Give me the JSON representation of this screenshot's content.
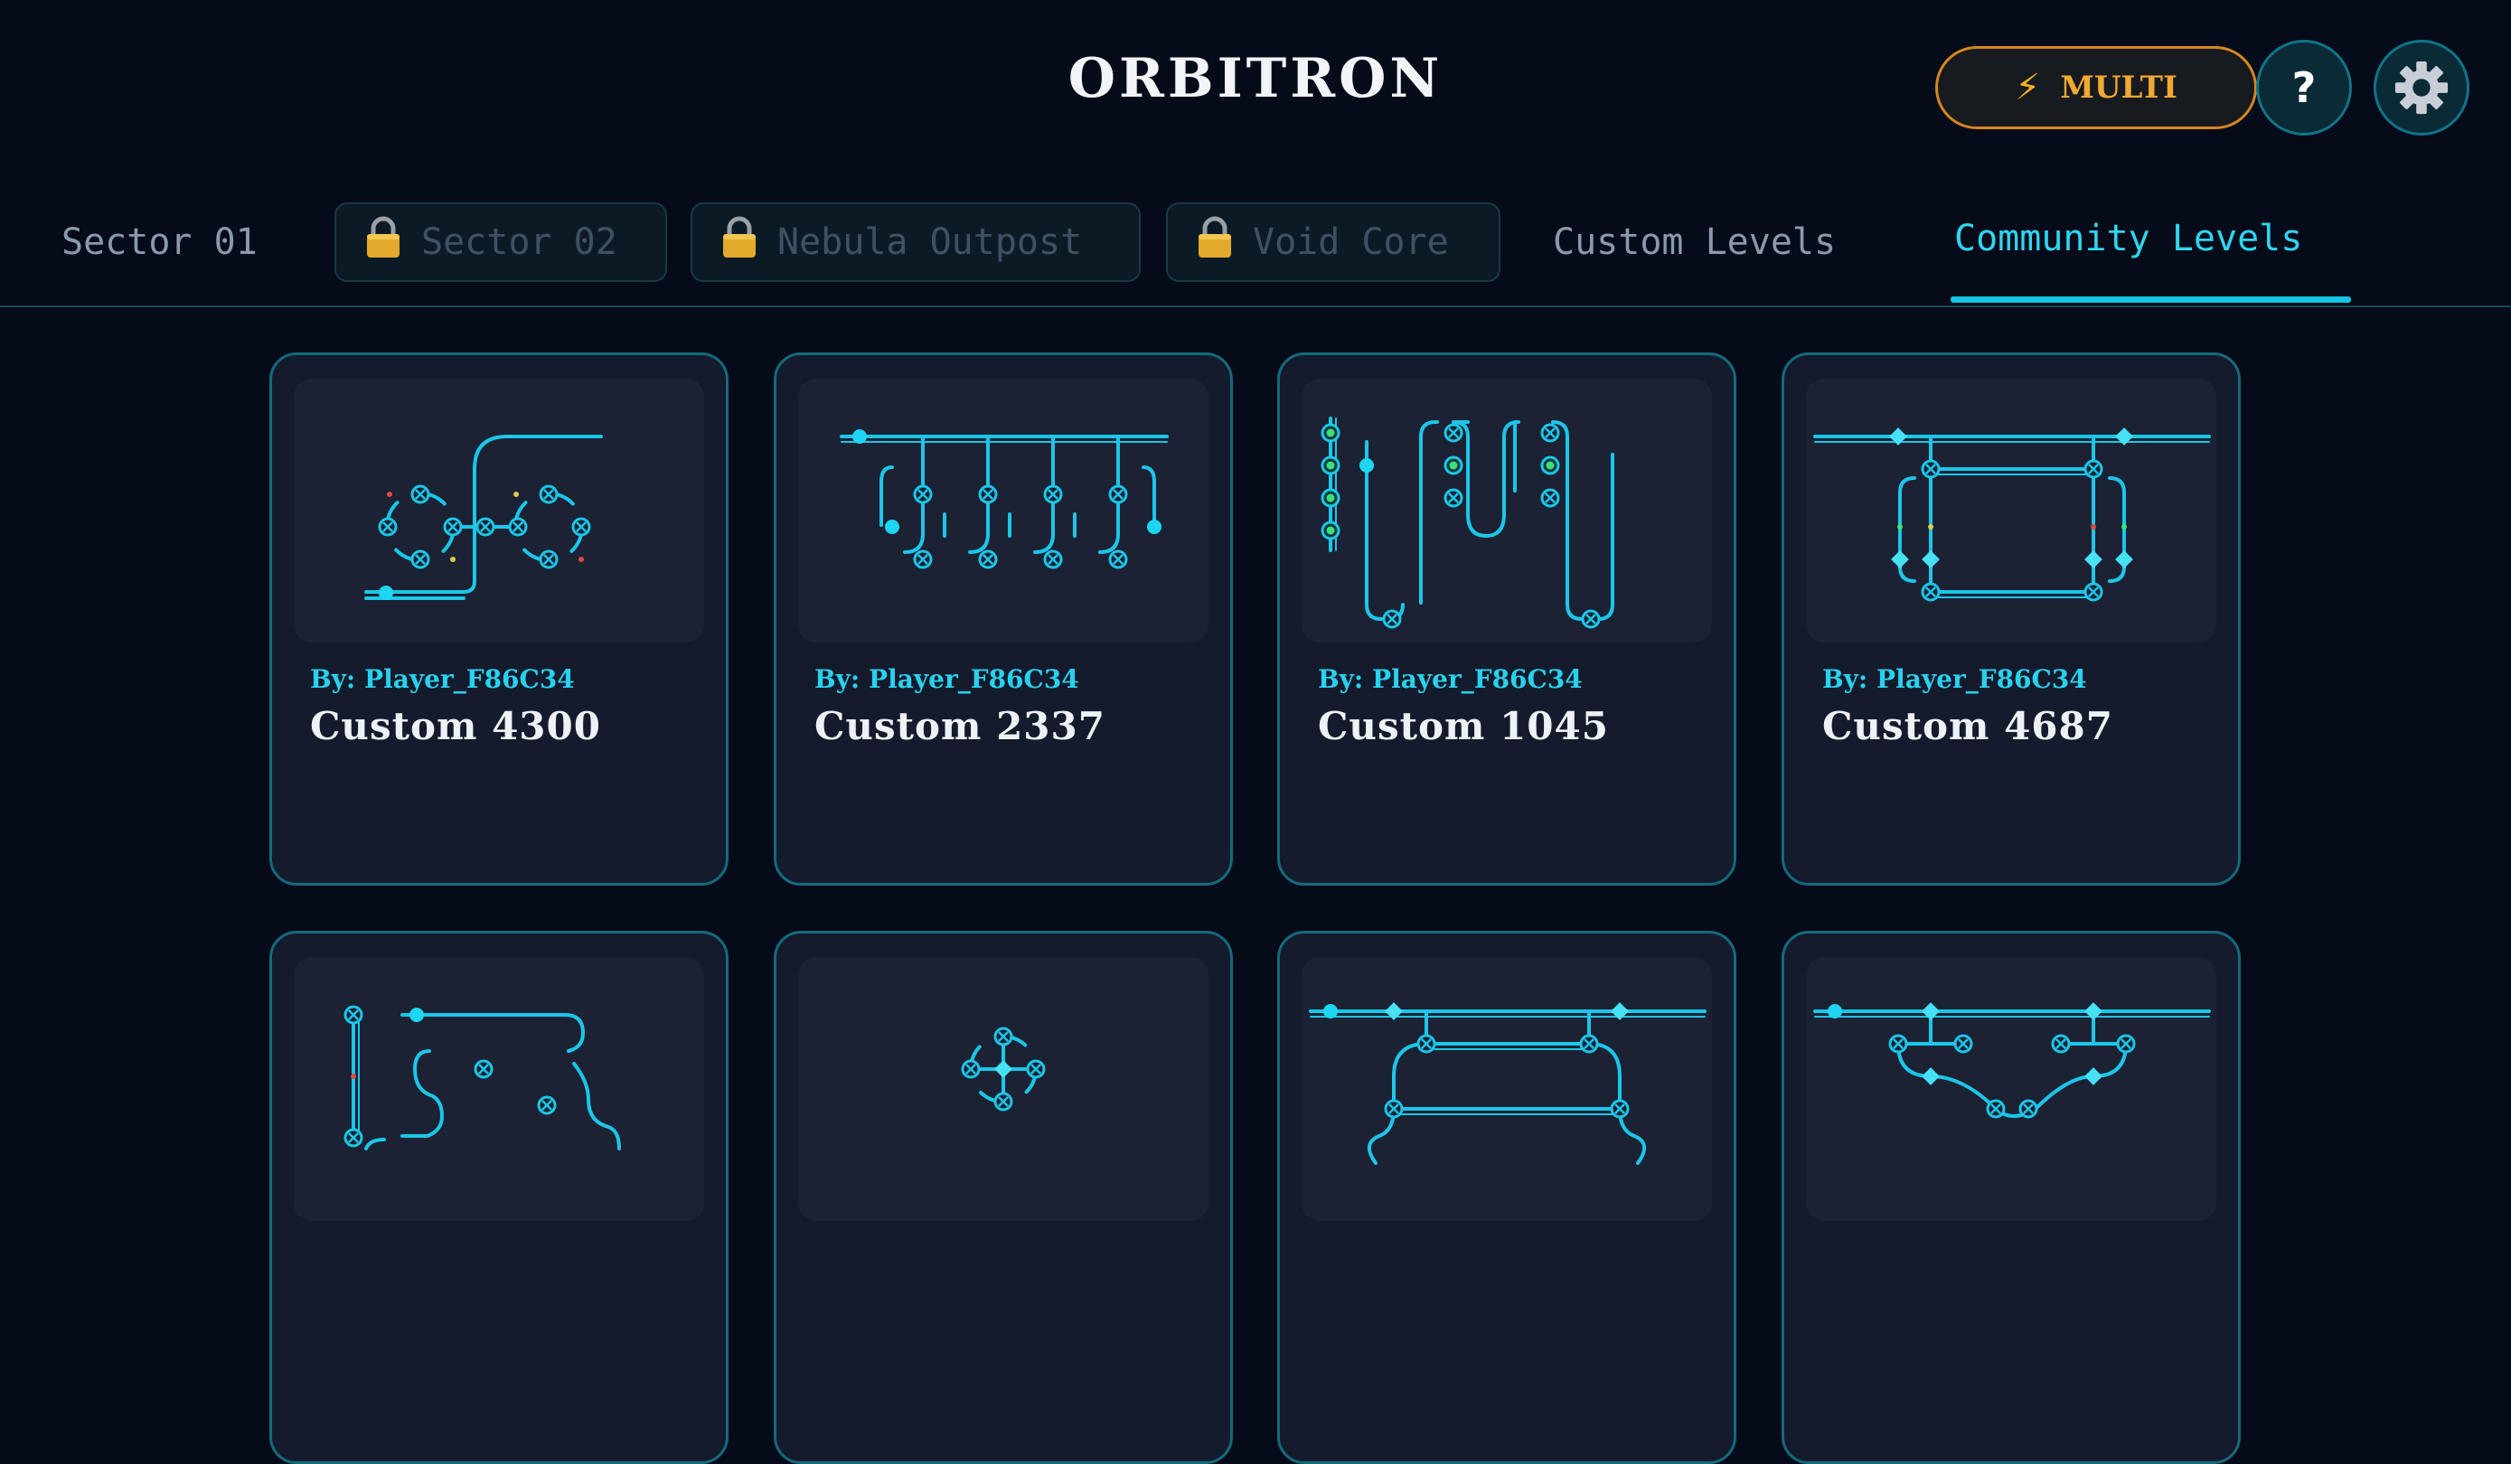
{
  "app": {
    "title": "ORBITRON"
  },
  "header": {
    "multi_label": "MULTI",
    "multi_icon": "lightning-bolt-icon",
    "help_label": "?",
    "settings_icon": "gear-icon"
  },
  "tabs": [
    {
      "label": "Sector 01",
      "locked": false,
      "active": false
    },
    {
      "label": "Sector 02",
      "locked": true,
      "active": false
    },
    {
      "label": "Nebula Outpost",
      "locked": true,
      "active": false
    },
    {
      "label": "Void Core",
      "locked": true,
      "active": false
    },
    {
      "label": "Custom Levels",
      "locked": false,
      "active": false
    },
    {
      "label": "Community Levels",
      "locked": false,
      "active": true
    }
  ],
  "cards": [
    {
      "author": "By: Player_F86C34",
      "name": "Custom 4300"
    },
    {
      "author": "By: Player_F86C34",
      "name": "Custom 2337"
    },
    {
      "author": "By: Player_F86C34",
      "name": "Custom 1045"
    },
    {
      "author": "By: Player_F86C34",
      "name": "Custom 4687"
    },
    {
      "author": "",
      "name": ""
    },
    {
      "author": "",
      "name": ""
    },
    {
      "author": "",
      "name": ""
    },
    {
      "author": "",
      "name": ""
    }
  ],
  "colors": {
    "accent": "#14c5e6",
    "multi": "#f0a932",
    "background": "#050b18",
    "card": "#141b2c"
  }
}
